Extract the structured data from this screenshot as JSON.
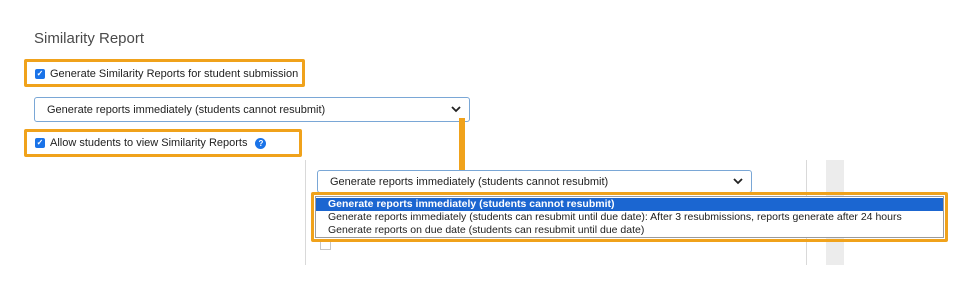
{
  "section_title": "Similarity Report",
  "checkbox_generate": {
    "label": "Generate Similarity Reports for student submission",
    "checked": true
  },
  "select_top": {
    "value": "Generate reports immediately (students cannot resubmit)",
    "icon": "chevron-down-icon"
  },
  "checkbox_allow": {
    "label": "Allow students to view Similarity Reports",
    "checked": true,
    "info_icon": "?"
  },
  "select_bottom": {
    "value": "Generate reports immediately (students cannot resubmit)",
    "icon": "chevron-down-icon"
  },
  "dropdown_options": [
    {
      "label": "Generate reports immediately (students cannot resubmit)",
      "selected": true
    },
    {
      "label": "Generate reports immediately (students can resubmit until due date): After 3 resubmissions, reports generate after 24 hours",
      "selected": false
    },
    {
      "label": "Generate reports on due date (students can resubmit until due date)",
      "selected": false
    }
  ],
  "colors": {
    "highlight": "#f0a21b",
    "selected_option": "#1b66d1",
    "checkbox": "#1a73e8"
  }
}
